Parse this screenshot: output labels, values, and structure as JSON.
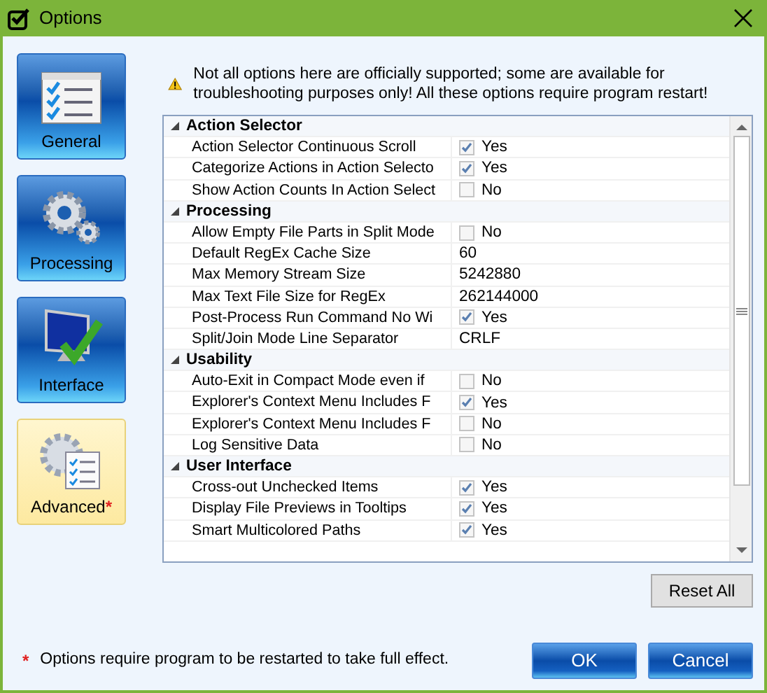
{
  "window": {
    "title": "Options"
  },
  "nav": [
    {
      "label": "General",
      "selected": false
    },
    {
      "label": "Processing",
      "selected": false
    },
    {
      "label": "Interface",
      "selected": false
    },
    {
      "label": "Advanced",
      "selected": true,
      "mark": "*"
    }
  ],
  "warning": "Not all options here are officially supported; some are available for troubleshooting purposes only! All these options require program restart!",
  "categories": [
    {
      "name": "Action Selector",
      "expanded": true,
      "items": [
        {
          "name": "Action Selector Continuous Scroll",
          "kind": "check",
          "checked": true,
          "value": "Yes"
        },
        {
          "name": "Categorize Actions in Action Selecto",
          "kind": "check",
          "checked": true,
          "value": "Yes"
        },
        {
          "name": "Show Action Counts In Action Select",
          "kind": "check",
          "checked": false,
          "value": "No"
        }
      ]
    },
    {
      "name": "Processing",
      "expanded": true,
      "items": [
        {
          "name": "Allow Empty File Parts in Split Mode",
          "kind": "check",
          "checked": false,
          "value": "No"
        },
        {
          "name": "Default RegEx Cache Size",
          "kind": "text",
          "value": "60"
        },
        {
          "name": "Max Memory Stream Size",
          "kind": "text",
          "value": "5242880"
        },
        {
          "name": "Max Text File Size for RegEx",
          "kind": "text",
          "value": "262144000"
        },
        {
          "name": "Post-Process Run Command No Wi",
          "kind": "check",
          "checked": true,
          "value": "Yes"
        },
        {
          "name": "Split/Join Mode Line Separator",
          "kind": "text",
          "value": "CRLF"
        }
      ]
    },
    {
      "name": "Usability",
      "expanded": true,
      "items": [
        {
          "name": "Auto-Exit in Compact Mode even if",
          "kind": "check",
          "checked": false,
          "value": "No"
        },
        {
          "name": "Explorer's Context Menu Includes F",
          "kind": "check",
          "checked": true,
          "value": "Yes"
        },
        {
          "name": "Explorer's Context Menu Includes F",
          "kind": "check",
          "checked": false,
          "value": "No"
        },
        {
          "name": "Log Sensitive Data",
          "kind": "check",
          "checked": false,
          "value": "No"
        }
      ]
    },
    {
      "name": "User Interface",
      "expanded": true,
      "items": [
        {
          "name": "Cross-out Unchecked Items",
          "kind": "check",
          "checked": true,
          "value": "Yes"
        },
        {
          "name": "Display File Previews in Tooltips",
          "kind": "check",
          "checked": true,
          "value": "Yes"
        },
        {
          "name": "Smart Multicolored Paths",
          "kind": "check",
          "checked": true,
          "value": "Yes"
        }
      ]
    }
  ],
  "reset_button": "Reset All",
  "footnote": {
    "mark": "*",
    "text": "Options require program to be restarted to take full effect."
  },
  "buttons": [
    "OK",
    "Cancel"
  ]
}
